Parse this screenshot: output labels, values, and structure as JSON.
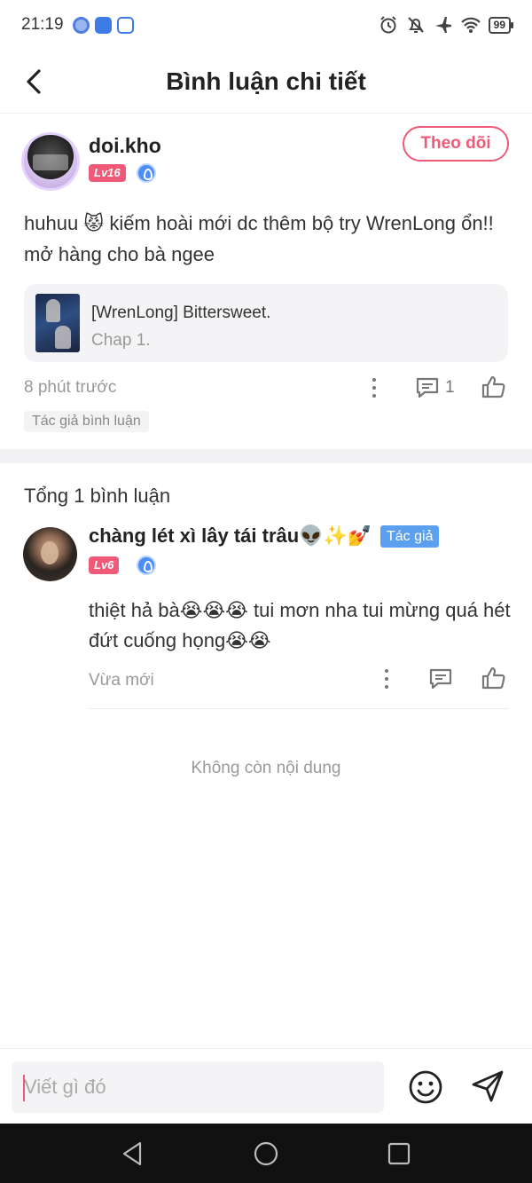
{
  "status_bar": {
    "time": "21:19",
    "battery": "99"
  },
  "header": {
    "title": "Bình luận chi tiết"
  },
  "main_comment": {
    "username": "doi.kho",
    "level": "Lv16",
    "follow_label": "Theo dõi",
    "text": "huhuu 😾 kiếm hoài mới dc thêm bộ try WrenLong ổn!! mở hàng cho bà ngee",
    "story": {
      "title": "[WrenLong] Bittersweet.",
      "chapter": "Chap 1."
    },
    "time": "8 phút trước",
    "reply_count": "1",
    "author_tag": "Tác giả bình luận"
  },
  "replies_section": {
    "total": "Tổng 1 bình luận",
    "items": [
      {
        "username": "chàng lét xì lây tái trâu👽✨💅",
        "badge": "Tác giả",
        "level": "Lv6",
        "text": "thiệt hả bà😭😭😭 tui mơn nha tui mừng quá hét đứt cuống họng😭😭",
        "time": "Vừa mới"
      }
    ],
    "end_text": "Không còn nội dung"
  },
  "input": {
    "placeholder": "Viết gì đó"
  },
  "colors": {
    "accent": "#f05a78",
    "author_badge": "#5ba0ee",
    "verified": "#4c8df6"
  }
}
